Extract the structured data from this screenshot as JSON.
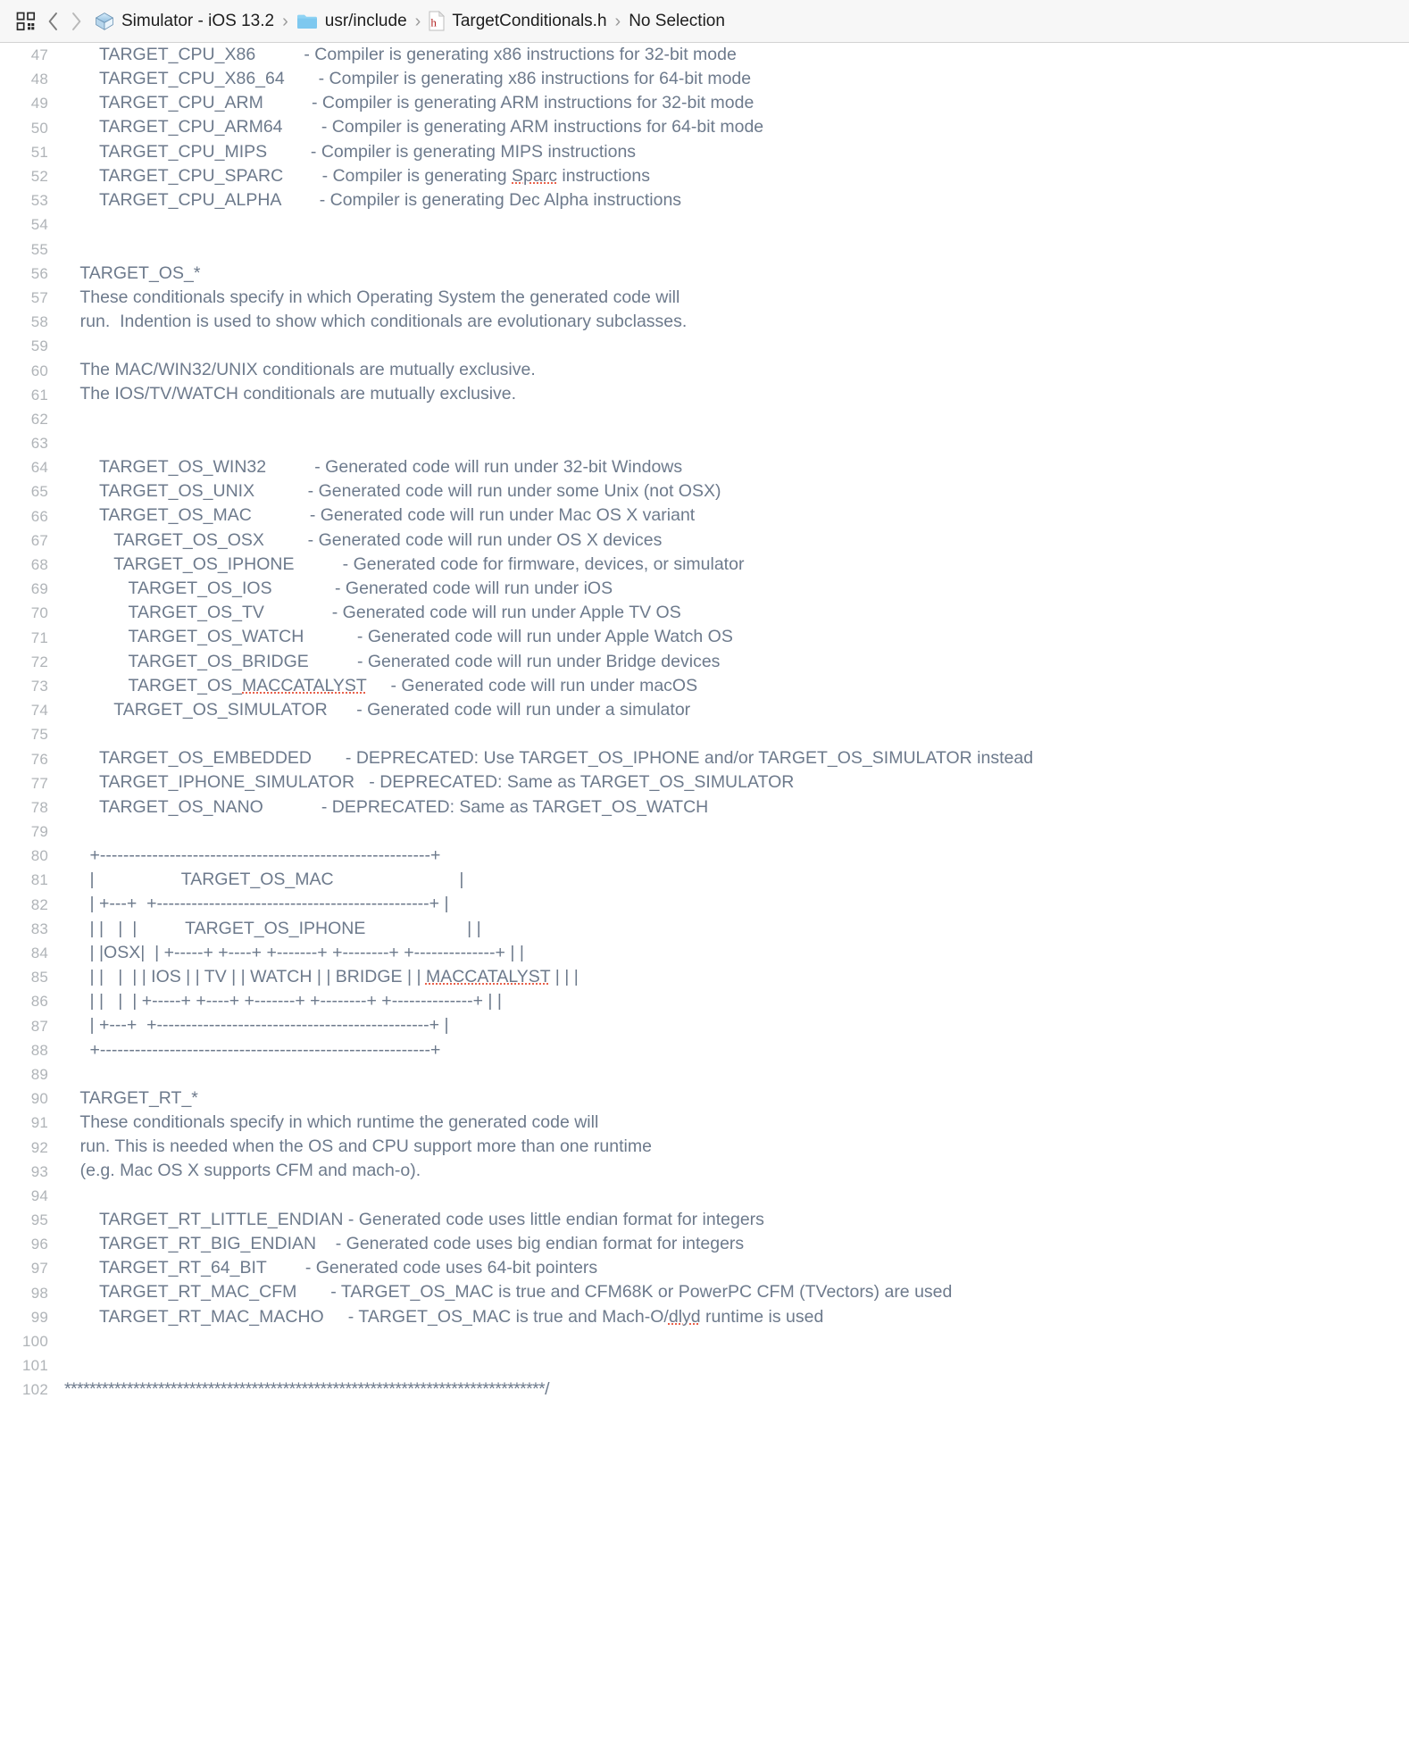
{
  "window": {
    "app": "Xcode",
    "title": "TargetConditionals.h"
  },
  "jumpbar": {
    "grid_icon": "related-items-icon",
    "back_label": "‹",
    "forward_label": "›",
    "separator": "›",
    "breadcrumbs": [
      {
        "label": "Simulator - iOS 13.2",
        "icon": "simulator-icon"
      },
      {
        "label": "usr/include",
        "icon": "folder-icon"
      },
      {
        "label": "TargetConditionals.h",
        "icon": "header-file-icon"
      },
      {
        "label": "No Selection",
        "icon": "none"
      }
    ]
  },
  "editor": {
    "first_line_number": 47,
    "gutter_color": "#b0b4b8",
    "comment_color": "#6d7a8c",
    "background": "#ffffff",
    "spellcheck_color": "#e8604a",
    "lines": [
      {
        "n": 47,
        "text": "        TARGET_CPU_X86          - Compiler is generating x86 instructions for 32-bit mode"
      },
      {
        "n": 48,
        "text": "        TARGET_CPU_X86_64       - Compiler is generating x86 instructions for 64-bit mode"
      },
      {
        "n": 49,
        "text": "        TARGET_CPU_ARM          - Compiler is generating ARM instructions for 32-bit mode"
      },
      {
        "n": 50,
        "text": "        TARGET_CPU_ARM64        - Compiler is generating ARM instructions for 64-bit mode"
      },
      {
        "n": 51,
        "text": "        TARGET_CPU_MIPS         - Compiler is generating MIPS instructions"
      },
      {
        "n": 52,
        "text": "        TARGET_CPU_SPARC        - Compiler is generating Sparc instructions",
        "spell": [
          "Sparc"
        ]
      },
      {
        "n": 53,
        "text": "        TARGET_CPU_ALPHA        - Compiler is generating Dec Alpha instructions"
      },
      {
        "n": 54,
        "text": ""
      },
      {
        "n": 55,
        "text": ""
      },
      {
        "n": 56,
        "text": "    TARGET_OS_*"
      },
      {
        "n": 57,
        "text": "    These conditionals specify in which Operating System the generated code will"
      },
      {
        "n": 58,
        "text": "    run.  Indention is used to show which conditionals are evolutionary subclasses."
      },
      {
        "n": 59,
        "text": ""
      },
      {
        "n": 60,
        "text": "    The MAC/WIN32/UNIX conditionals are mutually exclusive."
      },
      {
        "n": 61,
        "text": "    The IOS/TV/WATCH conditionals are mutually exclusive."
      },
      {
        "n": 62,
        "text": ""
      },
      {
        "n": 63,
        "text": ""
      },
      {
        "n": 64,
        "text": "        TARGET_OS_WIN32          - Generated code will run under 32-bit Windows"
      },
      {
        "n": 65,
        "text": "        TARGET_OS_UNIX           - Generated code will run under some Unix (not OSX)"
      },
      {
        "n": 66,
        "text": "        TARGET_OS_MAC            - Generated code will run under Mac OS X variant"
      },
      {
        "n": 67,
        "text": "           TARGET_OS_OSX         - Generated code will run under OS X devices"
      },
      {
        "n": 68,
        "text": "           TARGET_OS_IPHONE          - Generated code for firmware, devices, or simulator"
      },
      {
        "n": 69,
        "text": "              TARGET_OS_IOS             - Generated code will run under iOS"
      },
      {
        "n": 70,
        "text": "              TARGET_OS_TV              - Generated code will run under Apple TV OS"
      },
      {
        "n": 71,
        "text": "              TARGET_OS_WATCH           - Generated code will run under Apple Watch OS"
      },
      {
        "n": 72,
        "text": "              TARGET_OS_BRIDGE          - Generated code will run under Bridge devices"
      },
      {
        "n": 73,
        "text": "              TARGET_OS_MACCATALYST     - Generated code will run under macOS",
        "spell": [
          "MACCATALYST"
        ]
      },
      {
        "n": 74,
        "text": "           TARGET_OS_SIMULATOR      - Generated code will run under a simulator"
      },
      {
        "n": 75,
        "text": ""
      },
      {
        "n": 76,
        "text": "        TARGET_OS_EMBEDDED       - DEPRECATED: Use TARGET_OS_IPHONE and/or TARGET_OS_SIMULATOR instead"
      },
      {
        "n": 77,
        "text": "        TARGET_IPHONE_SIMULATOR   - DEPRECATED: Same as TARGET_OS_SIMULATOR"
      },
      {
        "n": 78,
        "text": "        TARGET_OS_NANO            - DEPRECATED: Same as TARGET_OS_WATCH"
      },
      {
        "n": 79,
        "text": ""
      },
      {
        "n": 80,
        "text": "      +---------------------------------------------------------+"
      },
      {
        "n": 81,
        "text": "      |                  TARGET_OS_MAC                          |"
      },
      {
        "n": 82,
        "text": "      | +---+  +-----------------------------------------------+ |"
      },
      {
        "n": 83,
        "text": "      | |   |  |          TARGET_OS_IPHONE                     | |"
      },
      {
        "n": 84,
        "text": "      | |OSX|  | +-----+ +----+ +-------+ +--------+ +--------------+ | |"
      },
      {
        "n": 85,
        "text": "      | |   |  | | IOS | | TV | | WATCH | | BRIDGE | | MACCATALYST | | |",
        "spell": [
          "MACCATALYST"
        ]
      },
      {
        "n": 86,
        "text": "      | |   |  | +-----+ +----+ +-------+ +--------+ +--------------+ | |"
      },
      {
        "n": 87,
        "text": "      | +---+  +-----------------------------------------------+ |"
      },
      {
        "n": 88,
        "text": "      +---------------------------------------------------------+"
      },
      {
        "n": 89,
        "text": ""
      },
      {
        "n": 90,
        "text": "    TARGET_RT_*"
      },
      {
        "n": 91,
        "text": "    These conditionals specify in which runtime the generated code will"
      },
      {
        "n": 92,
        "text": "    run. This is needed when the OS and CPU support more than one runtime"
      },
      {
        "n": 93,
        "text": "    (e.g. Mac OS X supports CFM and mach-o)."
      },
      {
        "n": 94,
        "text": ""
      },
      {
        "n": 95,
        "text": "        TARGET_RT_LITTLE_ENDIAN - Generated code uses little endian format for integers"
      },
      {
        "n": 96,
        "text": "        TARGET_RT_BIG_ENDIAN    - Generated code uses big endian format for integers"
      },
      {
        "n": 97,
        "text": "        TARGET_RT_64_BIT        - Generated code uses 64-bit pointers"
      },
      {
        "n": 98,
        "text": "        TARGET_RT_MAC_CFM       - TARGET_OS_MAC is true and CFM68K or PowerPC CFM (TVectors) are used"
      },
      {
        "n": 99,
        "text": "        TARGET_RT_MAC_MACHO     - TARGET_OS_MAC is true and Mach-O/dlyd runtime is used",
        "spell": [
          "dlyd"
        ]
      },
      {
        "n": 100,
        "text": ""
      },
      {
        "n": 101,
        "text": ""
      },
      {
        "n": 102,
        "text": "*****************************************************************************/",
        "tight": true
      }
    ]
  }
}
